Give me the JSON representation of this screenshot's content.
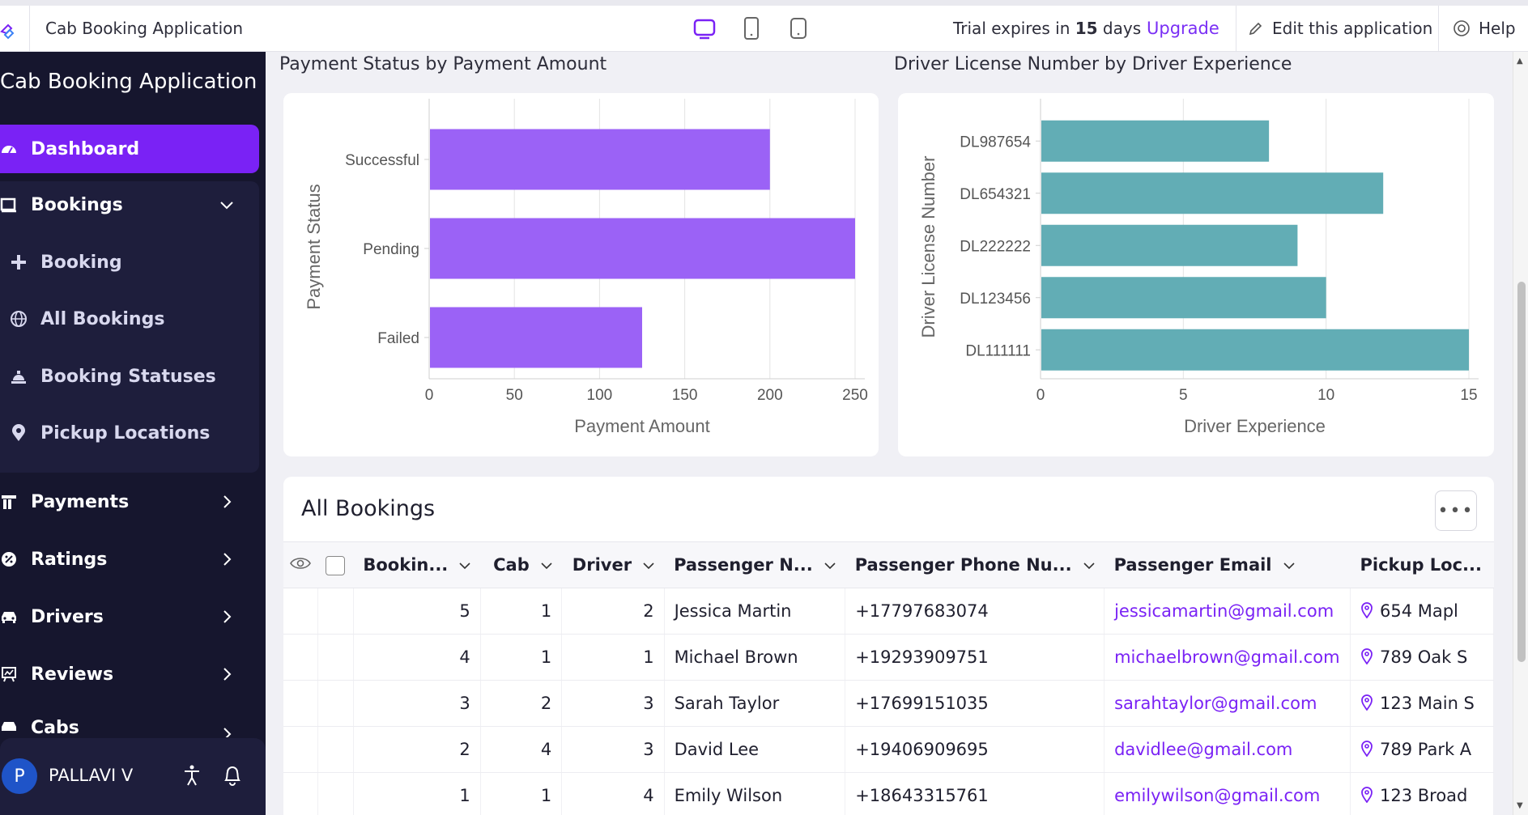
{
  "topbar": {
    "app_title": "Cab Booking Application",
    "trial_prefix": "Trial expires in ",
    "trial_days": "15",
    "trial_suffix": " days",
    "upgrade": "Upgrade",
    "edit": "Edit this application",
    "help": "Help"
  },
  "sidebar": {
    "title": "Cab Booking Application",
    "items": [
      {
        "label": "Dashboard",
        "icon": "dashboard-icon"
      },
      {
        "label": "Bookings",
        "icon": "bookings-icon"
      },
      {
        "label": "Booking",
        "icon": "plus-icon"
      },
      {
        "label": "All Bookings",
        "icon": "globe-icon"
      },
      {
        "label": "Booking Statuses",
        "icon": "bell-desk-icon"
      },
      {
        "label": "Pickup Locations",
        "icon": "location-icon"
      },
      {
        "label": "Payments",
        "icon": "payments-icon"
      },
      {
        "label": "Ratings",
        "icon": "ratings-icon"
      },
      {
        "label": "Drivers",
        "icon": "car-icon"
      },
      {
        "label": "Reviews",
        "icon": "reviews-icon"
      },
      {
        "label": "Cabs",
        "icon": "cab-icon"
      }
    ],
    "user": {
      "initial": "P",
      "name": "PALLAVI V"
    }
  },
  "chart_data": [
    {
      "type": "bar",
      "orientation": "horizontal",
      "title": "Payment Status by Payment Amount",
      "xlabel": "Payment Amount",
      "ylabel": "Payment Status",
      "categories": [
        "Successful",
        "Pending",
        "Failed"
      ],
      "values": [
        200,
        250,
        125
      ],
      "xlim": [
        0,
        250
      ],
      "xticks": [
        "0",
        "50",
        "100",
        "150",
        "200",
        "250"
      ],
      "color": "#9b62f6",
      "grid": true
    },
    {
      "type": "bar",
      "orientation": "horizontal",
      "title": "Driver License Number by Driver Experience",
      "xlabel": "Driver Experience",
      "ylabel": "Driver License Number",
      "categories": [
        "DL987654",
        "DL654321",
        "DL222222",
        "DL123456",
        "DL111111"
      ],
      "values": [
        8,
        12,
        9,
        10,
        15
      ],
      "xlim": [
        0,
        15
      ],
      "xticks": [
        "0",
        "5",
        "10",
        "15"
      ],
      "color": "#62adb5",
      "grid": true
    }
  ],
  "table": {
    "title": "All Bookings",
    "more": "•••",
    "columns": [
      "Bookin...",
      "Cab",
      "Driver",
      "Passenger N...",
      "Passenger Phone Nu...",
      "Passenger Email",
      "Pickup Loc..."
    ],
    "rows": [
      [
        "5",
        "1",
        "2",
        "Jessica Martin",
        "+17797683074",
        "jessicamartin@gmail.com",
        "654 Mapl"
      ],
      [
        "4",
        "1",
        "1",
        "Michael Brown",
        "+19293909751",
        "michaelbrown@gmail.com",
        "789 Oak S"
      ],
      [
        "3",
        "2",
        "3",
        "Sarah Taylor",
        "+17699151035",
        "sarahtaylor@gmail.com",
        "123 Main S"
      ],
      [
        "2",
        "4",
        "3",
        "David Lee",
        "+19406909695",
        "davidlee@gmail.com",
        "789 Park A"
      ],
      [
        "1",
        "1",
        "4",
        "Emily Wilson",
        "+18643315761",
        "emilywilson@gmail.com",
        "123 Broad"
      ]
    ]
  }
}
